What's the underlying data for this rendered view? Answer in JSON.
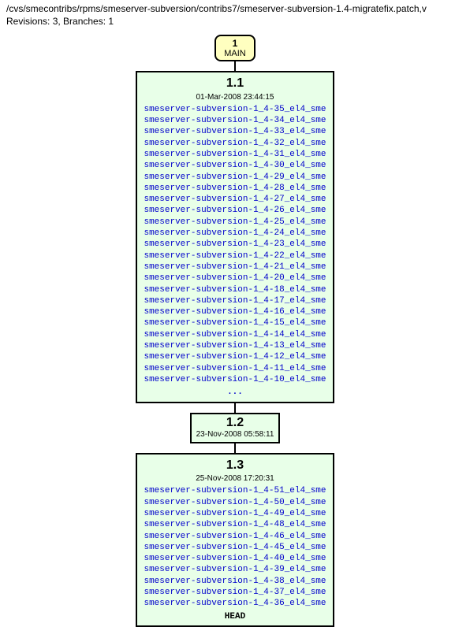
{
  "header": {
    "path": "/cvs/smecontribs/rpms/smeserver-subversion/contribs7/smeserver-subversion-1.4-migratefix.patch,v",
    "stats": "Revisions: 3, Branches: 1"
  },
  "branch": {
    "number": "1",
    "name": "MAIN"
  },
  "revisions": [
    {
      "number": "1.1",
      "date": "01-Mar-2008 23:44:15",
      "tags": [
        "smeserver-subversion-1_4-35_el4_sme",
        "smeserver-subversion-1_4-34_el4_sme",
        "smeserver-subversion-1_4-33_el4_sme",
        "smeserver-subversion-1_4-32_el4_sme",
        "smeserver-subversion-1_4-31_el4_sme",
        "smeserver-subversion-1_4-30_el4_sme",
        "smeserver-subversion-1_4-29_el4_sme",
        "smeserver-subversion-1_4-28_el4_sme",
        "smeserver-subversion-1_4-27_el4_sme",
        "smeserver-subversion-1_4-26_el4_sme",
        "smeserver-subversion-1_4-25_el4_sme",
        "smeserver-subversion-1_4-24_el4_sme",
        "smeserver-subversion-1_4-23_el4_sme",
        "smeserver-subversion-1_4-22_el4_sme",
        "smeserver-subversion-1_4-21_el4_sme",
        "smeserver-subversion-1_4-20_el4_sme",
        "smeserver-subversion-1_4-18_el4_sme",
        "smeserver-subversion-1_4-17_el4_sme",
        "smeserver-subversion-1_4-16_el4_sme",
        "smeserver-subversion-1_4-15_el4_sme",
        "smeserver-subversion-1_4-14_el4_sme",
        "smeserver-subversion-1_4-13_el4_sme",
        "smeserver-subversion-1_4-12_el4_sme",
        "smeserver-subversion-1_4-11_el4_sme",
        "smeserver-subversion-1_4-10_el4_sme"
      ],
      "ellipsis": "..."
    },
    {
      "number": "1.2",
      "date": "23-Nov-2008 05:58:11",
      "tags": []
    },
    {
      "number": "1.3",
      "date": "25-Nov-2008 17:20:31",
      "tags": [
        "smeserver-subversion-1_4-51_el4_sme",
        "smeserver-subversion-1_4-50_el4_sme",
        "smeserver-subversion-1_4-49_el4_sme",
        "smeserver-subversion-1_4-48_el4_sme",
        "smeserver-subversion-1_4-46_el4_sme",
        "smeserver-subversion-1_4-45_el4_sme",
        "smeserver-subversion-1_4-40_el4_sme",
        "smeserver-subversion-1_4-39_el4_sme",
        "smeserver-subversion-1_4-38_el4_sme",
        "smeserver-subversion-1_4-37_el4_sme",
        "smeserver-subversion-1_4-36_el4_sme"
      ],
      "head": "HEAD"
    }
  ]
}
